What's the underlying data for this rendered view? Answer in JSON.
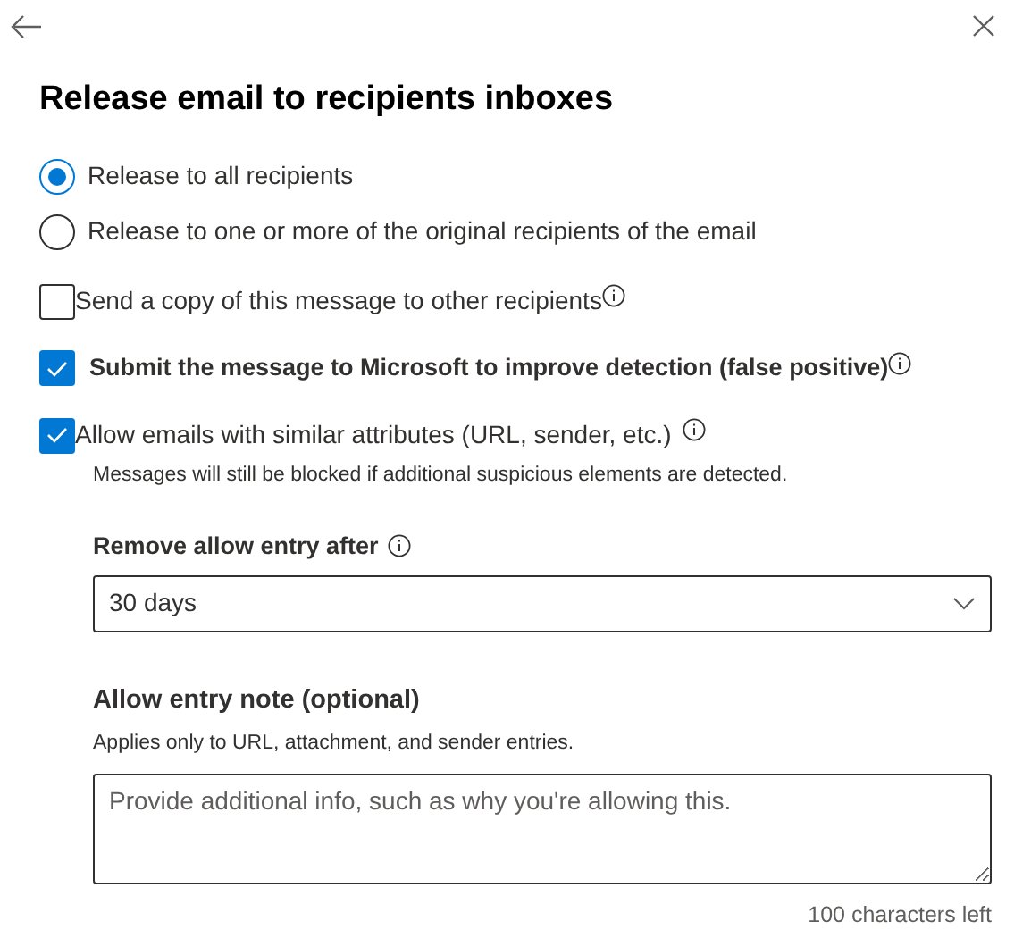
{
  "title": "Release email to recipients inboxes",
  "release_options": [
    {
      "label": "Release to all recipients",
      "selected": true
    },
    {
      "label": "Release to one or more of the original recipients of the email",
      "selected": false
    }
  ],
  "checkboxes": [
    {
      "label": "Send a copy of this message to other recipients",
      "checked": false,
      "bold": false,
      "info": true
    },
    {
      "label": "Submit the message to Microsoft to improve detection (false positive)",
      "checked": true,
      "bold": true,
      "info": true
    },
    {
      "label": "Allow emails with similar attributes (URL, sender, etc.)",
      "checked": true,
      "bold": false,
      "info": true,
      "description": "Messages will still be blocked if additional suspicious elements are detected."
    }
  ],
  "remove_after": {
    "label": "Remove allow entry after",
    "value": "30 days"
  },
  "note": {
    "label": "Allow entry note (optional)",
    "description": "Applies only to URL, attachment, and sender entries.",
    "placeholder": "Provide additional info, such as why you're allowing this.",
    "counter": "100 characters left"
  }
}
